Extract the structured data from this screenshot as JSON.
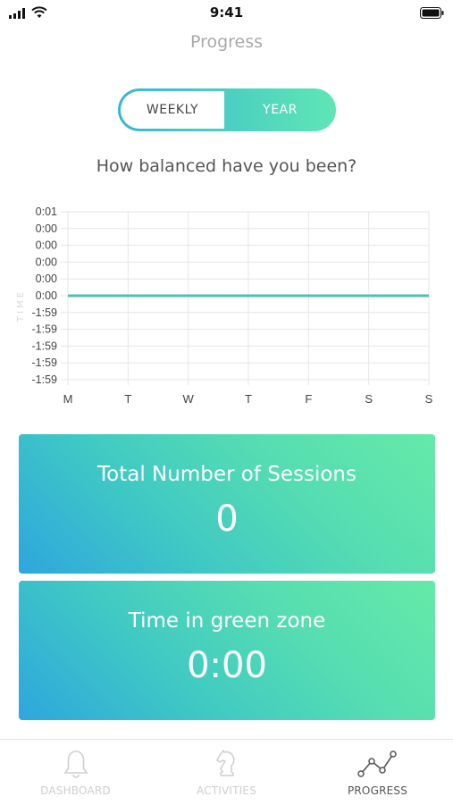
{
  "status_bar": {
    "time": "9:41"
  },
  "header": {
    "title": "Progress"
  },
  "segmented": {
    "weekly_label": "WEEKLY",
    "year_label": "YEAR",
    "selected": "YEAR"
  },
  "question": "How balanced have you been?",
  "chart_data": {
    "type": "line",
    "categories": [
      "M",
      "T",
      "W",
      "T",
      "F",
      "S",
      "S"
    ],
    "y_tick_labels": [
      "0:01",
      "0:00",
      "0:00",
      "0:00",
      "0:00",
      "0:00",
      "-1:59",
      "-1:59",
      "-1:59",
      "-1:59",
      "-1:59"
    ],
    "ylabel": "TIME",
    "series": [
      {
        "values": [
          0,
          0,
          0,
          0,
          0,
          0,
          0
        ],
        "color": "#4fbfb5"
      }
    ],
    "grid": true
  },
  "cards": [
    {
      "label": "Total Number of Sessions",
      "value": "0"
    },
    {
      "label": "Time in green zone",
      "value": "0:00"
    }
  ],
  "tab_bar": {
    "tabs": [
      {
        "label": "DASHBOARD",
        "icon": "bell-icon",
        "active": false
      },
      {
        "label": "ACTIVITIES",
        "icon": "chess-knight-icon",
        "active": false
      },
      {
        "label": "PROGRESS",
        "icon": "line-chart-icon",
        "active": true
      }
    ]
  },
  "colors": {
    "accent_start": "#2ea6de",
    "accent_end": "#65eaa8",
    "line": "#4fbfb5"
  }
}
